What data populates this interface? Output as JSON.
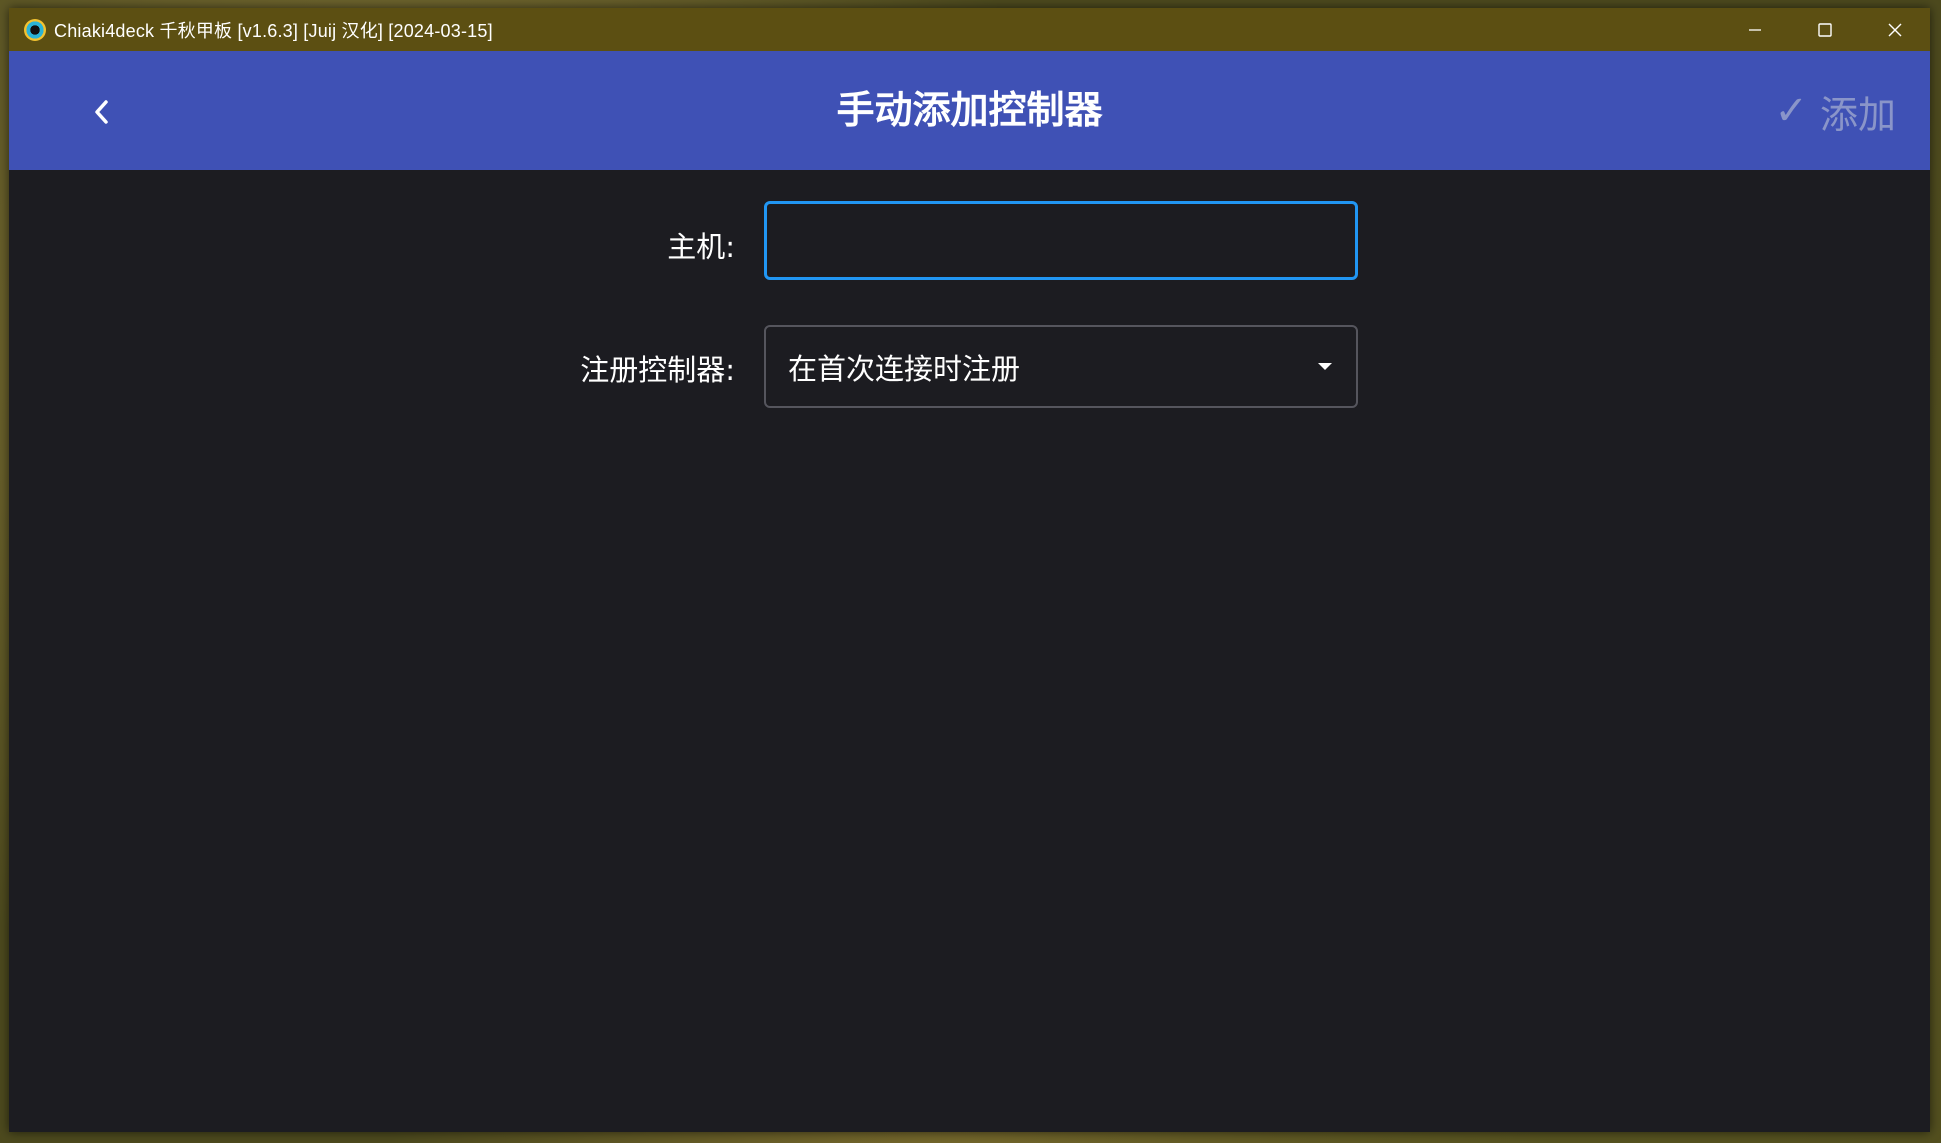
{
  "window": {
    "title": "Chiaki4deck 千秋甲板 [v1.6.3] [Juij 汉化] [2024-03-15]",
    "app_icon": "chiaki-app-icon",
    "controls": [
      "minimize-icon",
      "maximize-icon",
      "close-icon"
    ]
  },
  "appbar": {
    "back_icon": "chevron-left-icon",
    "title": "手动添加控制器",
    "add_check_icon": "check-icon",
    "add_label": "添加",
    "add_enabled": false
  },
  "form": {
    "host_label": "主机:",
    "host_value": "",
    "register_label": "注册控制器:",
    "register_selected": "在首次连接时注册"
  },
  "colors": {
    "titlebar": "#5c4f12",
    "appbar": "#3f51b5",
    "background": "#1c1c21",
    "focus_border": "#2196f3",
    "disabled_text": "#8a95c9"
  }
}
